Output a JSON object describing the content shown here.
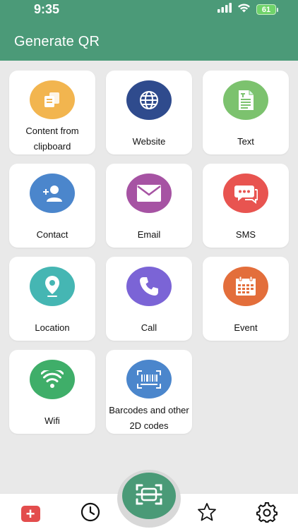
{
  "status_bar": {
    "time": "9:35",
    "battery": "61",
    "icons": [
      "cellular-signal-icon",
      "wifi-icon",
      "battery-icon"
    ]
  },
  "header": {
    "title": "Generate QR",
    "color": "#4b9a78"
  },
  "tiles": [
    {
      "label_lines": [
        "Content from",
        "clipboard"
      ],
      "icon": "clipboard-copy-icon",
      "color": "#f2b54f"
    },
    {
      "label_lines": [
        "Website"
      ],
      "icon": "globe-icon",
      "color": "#2f4b8d"
    },
    {
      "label_lines": [
        "Text"
      ],
      "icon": "document-text-icon",
      "color": "#7cc26e"
    },
    {
      "label_lines": [
        "Contact"
      ],
      "icon": "add-contact-icon",
      "color": "#4b86cc"
    },
    {
      "label_lines": [
        "Email"
      ],
      "icon": "envelope-icon",
      "color": "#a653a3"
    },
    {
      "label_lines": [
        "SMS"
      ],
      "icon": "chat-bubbles-icon",
      "color": "#e85450"
    },
    {
      "label_lines": [
        "Location"
      ],
      "icon": "map-pin-icon",
      "color": "#45b6b3"
    },
    {
      "label_lines": [
        "Call"
      ],
      "icon": "phone-icon",
      "color": "#7b64d6"
    },
    {
      "label_lines": [
        "Event"
      ],
      "icon": "calendar-icon",
      "color": "#e36e3b"
    },
    {
      "label_lines": [
        "Wifi"
      ],
      "icon": "wifi-icon",
      "color": "#3fae69"
    },
    {
      "label_lines": [
        "Barcodes and other",
        "2D codes"
      ],
      "icon": "barcode-icon",
      "color": "#4b86cc"
    }
  ],
  "bottom_nav": {
    "items": [
      {
        "name": "generate",
        "icon": "plus-square-icon",
        "active": true,
        "color": "#e34d4d"
      },
      {
        "name": "history",
        "icon": "clock-icon",
        "active": false
      },
      {
        "name": "scan",
        "icon": "scan-icon",
        "active": false,
        "color": "#4a9a77"
      },
      {
        "name": "favorites",
        "icon": "star-icon",
        "active": false
      },
      {
        "name": "settings",
        "icon": "gear-icon",
        "active": false
      }
    ]
  }
}
